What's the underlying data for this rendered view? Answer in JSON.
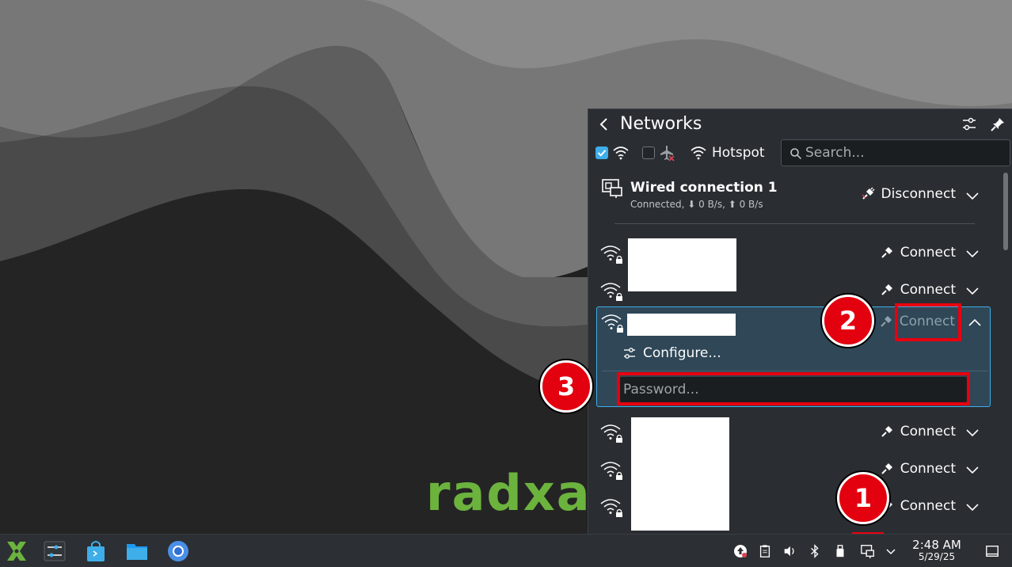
{
  "desktop": {
    "brand_text": "radxa"
  },
  "panel": {
    "title": "Networks",
    "hotspot_label": "Hotspot",
    "search_placeholder": "Search...",
    "wifi_enabled": true,
    "airplane_mode": false
  },
  "wired": {
    "name": "Wired connection 1",
    "status": "Connected, ⬇ 0 B/s, ⬆ 0 B/s",
    "action": "Disconnect"
  },
  "networks": [
    {
      "name": "",
      "action": "Connect"
    },
    {
      "name": "",
      "action": "Connect"
    },
    {
      "name": "",
      "action": "Connect",
      "expanded": true
    },
    {
      "name": "",
      "action": "Connect"
    },
    {
      "name": "",
      "action": "Connect"
    },
    {
      "name": "",
      "action": "Connect"
    }
  ],
  "expanded_item": {
    "configure_label": "Configure...",
    "password_placeholder": "Password..."
  },
  "annotations": {
    "step1": "1",
    "step2": "2",
    "step3": "3"
  },
  "taskbar": {
    "clock_time": "2:48 AM",
    "clock_date": "5/29/25"
  },
  "colors": {
    "accent": "#3daee9",
    "annotation_red": "#e3000f",
    "brand_green": "#6cb33e"
  }
}
